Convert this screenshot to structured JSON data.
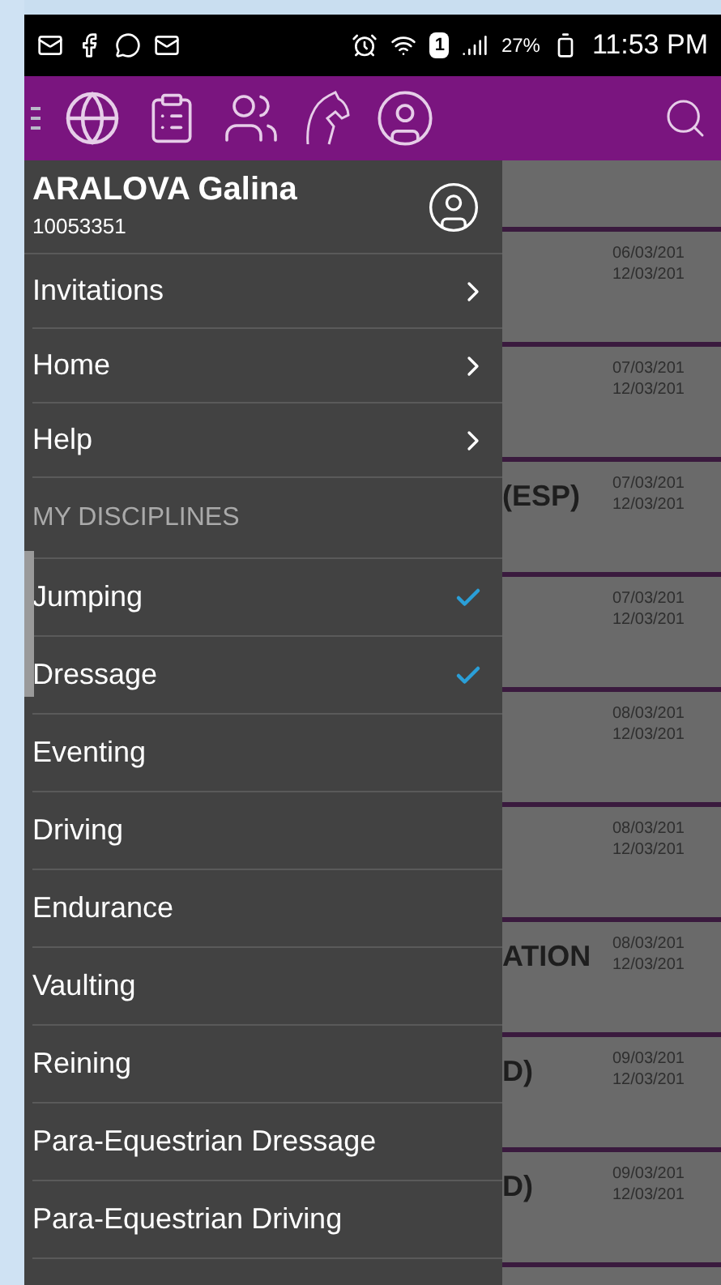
{
  "status_bar": {
    "sim": "1",
    "battery": "27%",
    "time": "11:53 PM"
  },
  "profile": {
    "name": "ARALOVA Galina",
    "id": "10053351"
  },
  "menu": [
    {
      "label": "Invitations"
    },
    {
      "label": "Home"
    },
    {
      "label": "Help"
    }
  ],
  "section_header": "MY DISCIPLINES",
  "disciplines": [
    {
      "label": "Jumping",
      "checked": true
    },
    {
      "label": "Dressage",
      "checked": true
    },
    {
      "label": "Eventing",
      "checked": false
    },
    {
      "label": "Driving",
      "checked": false
    },
    {
      "label": "Endurance",
      "checked": false
    },
    {
      "label": "Vaulting",
      "checked": false
    },
    {
      "label": "Reining",
      "checked": false
    },
    {
      "label": "Para-Equestrian Dressage",
      "checked": false
    },
    {
      "label": "Para-Equestrian Driving",
      "checked": false
    }
  ],
  "events": [
    {
      "start": "06/03/201",
      "end": "12/03/201"
    },
    {
      "start": "07/03/201",
      "end": "12/03/201"
    },
    {
      "title": "(ESP)",
      "start": "07/03/201",
      "end": "12/03/201"
    },
    {
      "start": "07/03/201",
      "end": "12/03/201"
    },
    {
      "start": "08/03/201",
      "end": "12/03/201"
    },
    {
      "start": "08/03/201",
      "end": "12/03/201"
    },
    {
      "title": "ATION",
      "start": "08/03/201",
      "end": "12/03/201"
    },
    {
      "title": "D)",
      "start": "09/03/201",
      "end": "12/03/201"
    },
    {
      "title": "D)",
      "start": "09/03/201",
      "end": "12/03/201"
    }
  ]
}
